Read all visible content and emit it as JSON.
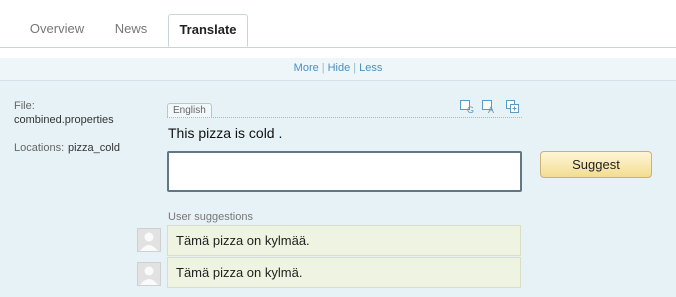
{
  "tabs": [
    {
      "label": "Overview"
    },
    {
      "label": "News"
    },
    {
      "label": "Translate"
    }
  ],
  "links": {
    "more": "More",
    "hide": "Hide",
    "less": "Less",
    "separator": "|"
  },
  "meta": {
    "file_label": "File:",
    "file_value": "combined.properties",
    "locations_label": "Locations:",
    "locations_value": "pizza_cold"
  },
  "source": {
    "language": "English",
    "text": "This pizza is cold ."
  },
  "translation": {
    "value": ""
  },
  "suggest_button": "Suggest",
  "suggestions": {
    "label": "User suggestions",
    "items": [
      {
        "text": "Tämä pizza on kylmää."
      },
      {
        "text": "Tämä pizza on kylmä."
      }
    ]
  },
  "colors": {
    "link": "#4a90c2",
    "panel": "#e7f2f7",
    "suggestion_bg": "#eff3e2",
    "button": "#f3dc92"
  }
}
